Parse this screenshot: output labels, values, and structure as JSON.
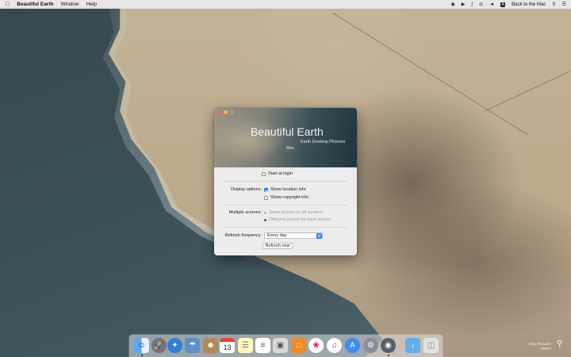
{
  "menubar": {
    "apple_icon": "apple-icon",
    "app_name": "Beautiful Earth",
    "menus": [
      "Window",
      "Help"
    ],
    "status_icons": [
      "eye-icon",
      "speaker-icon",
      "bluetooth-icon",
      "wifi-icon",
      "volume-icon",
      "keyboard-a-icon"
    ],
    "keyboard_badge": "A",
    "right_text": "Back to the Mac",
    "search_icon": "search-icon",
    "list_icon": "list-icon"
  },
  "window": {
    "title": "Beautiful Earth",
    "subtitle": "Earth Desktop Pictures",
    "subtitle2": "Mac",
    "start_at_login": {
      "label": "Start at login",
      "checked": false
    },
    "display_options": {
      "label": "Display options:",
      "show_location_info": {
        "label": "Show location info",
        "checked": true
      },
      "show_copyright_info": {
        "label": "Show copyright info",
        "checked": false
      }
    },
    "multiple_screens": {
      "label": "Multiple screens:",
      "options": [
        "Same picture on all screens",
        "Different picture for each screen"
      ],
      "selected": 1
    },
    "refresh_frequency": {
      "label": "Refresh frequency:",
      "value": "Every day"
    },
    "refresh_now_label": "Refresh now"
  },
  "dock": {
    "items": [
      "finder-icon",
      "launchpad-icon",
      "safari-icon",
      "photo-viewer-icon",
      "contacts-icon",
      "calendar-icon",
      "notes-icon",
      "reminders-icon",
      "photo-booth-icon",
      "books-icon",
      "photos-icon",
      "music-icon",
      "app-store-icon",
      "system-preferences-icon",
      "beautiful-earth-icon",
      "downloads-folder-icon",
      "trash-icon"
    ],
    "calendar_day": "13"
  },
  "location": {
    "line1": "Islay Pinnacle",
    "line2": "PERU"
  },
  "colors": {
    "accent": "#3a82f6",
    "close": "#fc605c",
    "minimize": "#fdbc40"
  }
}
